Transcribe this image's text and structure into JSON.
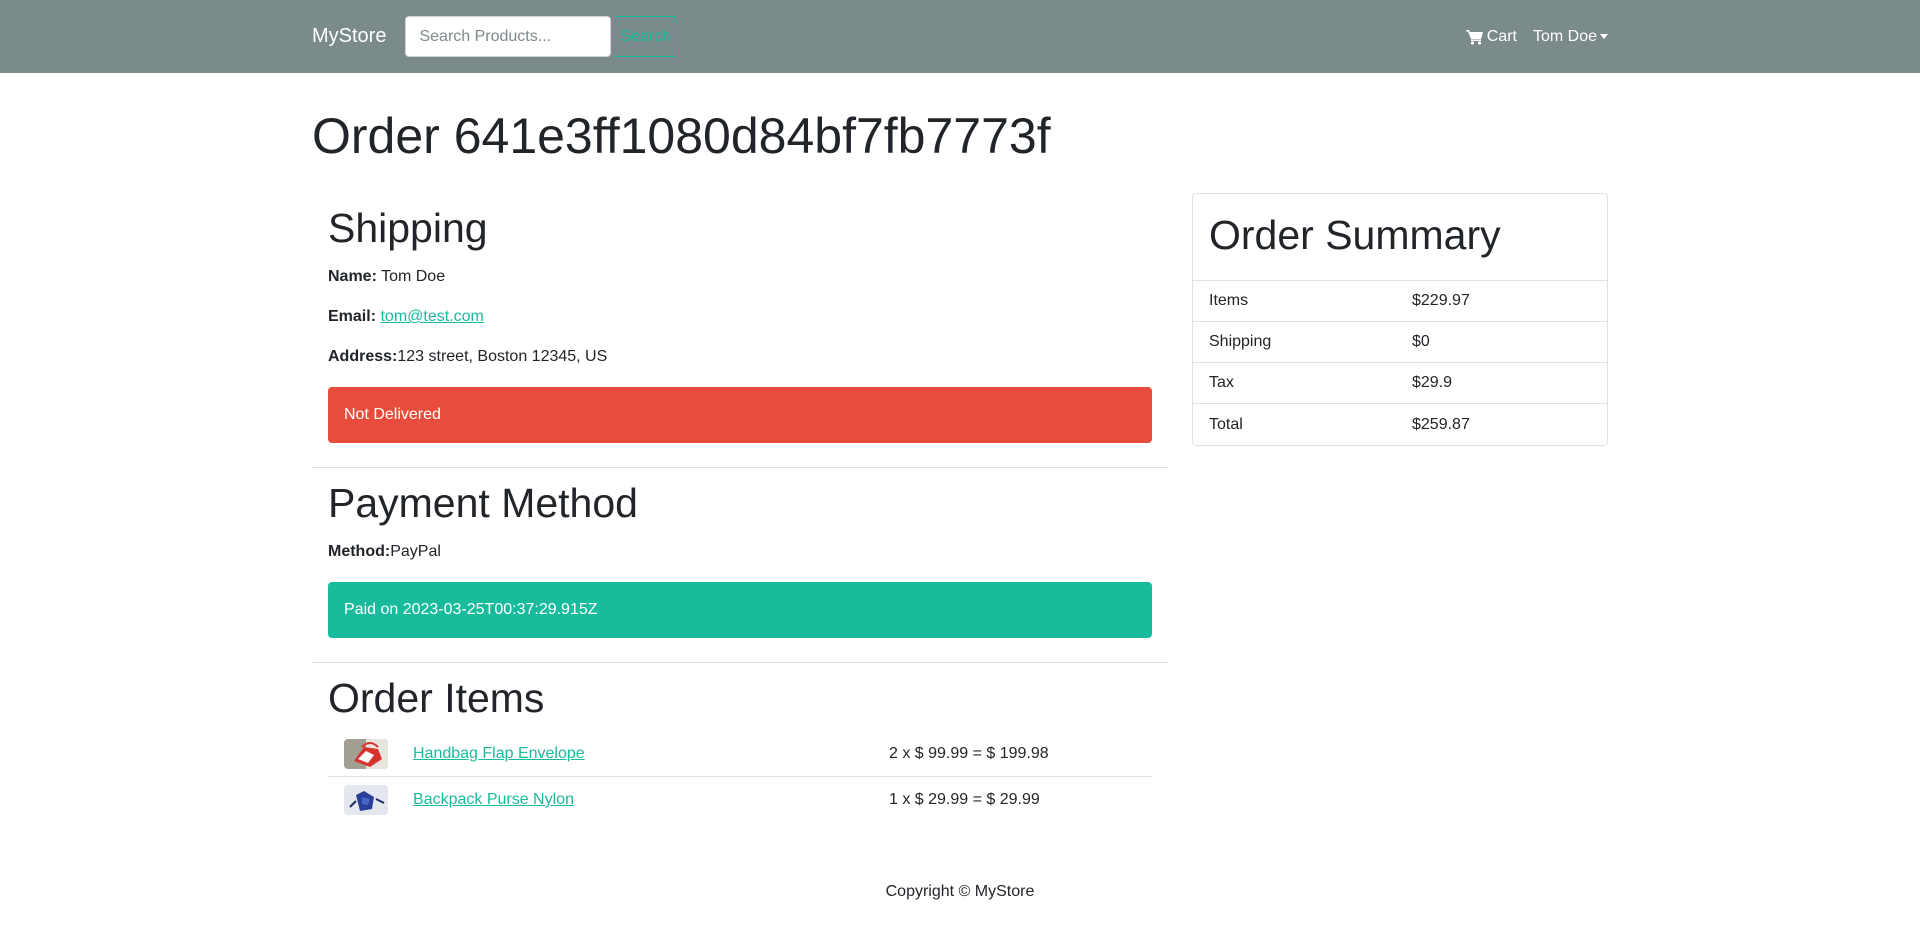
{
  "nav": {
    "brand": "MyStore",
    "search_placeholder": "Search Products...",
    "search_button": "Search",
    "cart_label": "Cart",
    "user_label": "Tom Doe"
  },
  "page": {
    "title": "Order 641e3ff1080d84bf7fb7773f"
  },
  "shipping": {
    "heading": "Shipping",
    "name_label": "Name:",
    "name_value": "Tom Doe",
    "email_label": "Email:",
    "email_value": "tom@test.com",
    "address_label": "Address:",
    "address_value": "123 street, Boston 12345, US",
    "status": "Not Delivered"
  },
  "payment": {
    "heading": "Payment Method",
    "method_label": "Method:",
    "method_value": "PayPal",
    "status": "Paid on 2023-03-25T00:37:29.915Z"
  },
  "order_items": {
    "heading": "Order Items",
    "items": [
      {
        "name": "Handbag Flap Envelope",
        "calc": "2 x $ 99.99 = $ 199.98"
      },
      {
        "name": "Backpack Purse Nylon",
        "calc": "1 x $ 29.99 = $ 29.99"
      }
    ]
  },
  "summary": {
    "heading": "Order Summary",
    "rows": [
      {
        "label": "Items",
        "value": "$229.97"
      },
      {
        "label": "Shipping",
        "value": "$0"
      },
      {
        "label": "Tax",
        "value": "$29.9"
      },
      {
        "label": "Total",
        "value": "$259.87"
      }
    ]
  },
  "footer": {
    "text": "Copyright © MyStore"
  },
  "colors": {
    "navbar": "#7b8a8b",
    "accent": "#18bc9c",
    "danger": "#e74c3c"
  }
}
